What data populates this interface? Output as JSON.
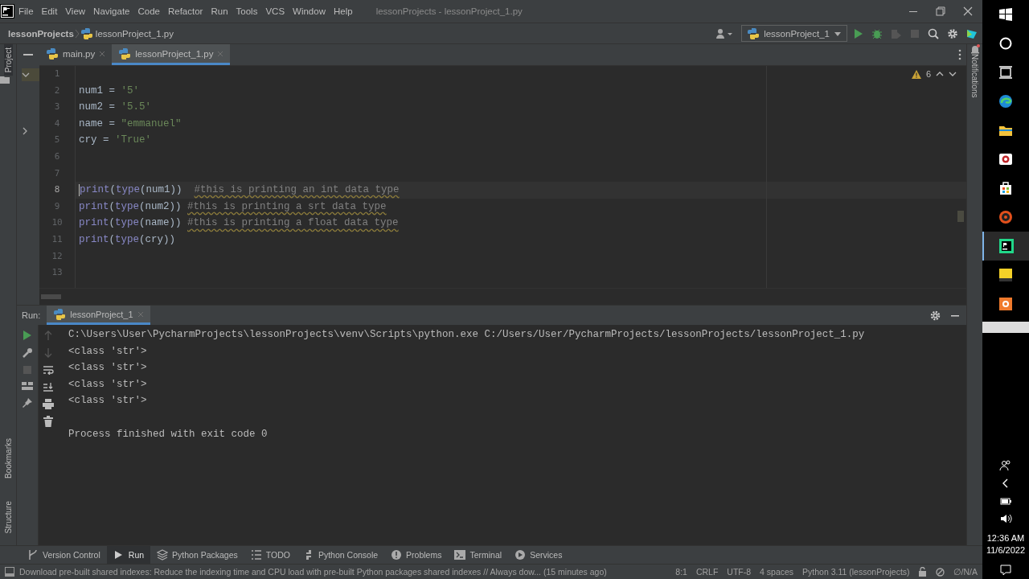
{
  "title_bar": {
    "menu": [
      "File",
      "Edit",
      "View",
      "Navigate",
      "Code",
      "Refactor",
      "Run",
      "Tools",
      "VCS",
      "Window",
      "Help"
    ],
    "title": "lessonProjects - lessonProject_1.py"
  },
  "nav_bar": {
    "breadcrumbs": [
      "lessonProjects",
      "lessonProject_1.py"
    ],
    "run_config": "lessonProject_1"
  },
  "left_strip": {
    "top": "Project",
    "bottom": [
      "Bookmarks",
      "Structure"
    ]
  },
  "right_strip": {
    "label": "Notifications"
  },
  "editor": {
    "tabs": [
      {
        "label": "main.py",
        "selected": false
      },
      {
        "label": "lessonProject_1.py",
        "selected": true
      }
    ],
    "warnings": "6",
    "lines": [
      {
        "number": "1",
        "current": false
      },
      {
        "number": "2",
        "current": false,
        "tokens": [
          {
            "kind": "ident",
            "text": "num1"
          },
          {
            "kind": "op",
            "text": " = "
          },
          {
            "kind": "str",
            "text": "'5'"
          }
        ]
      },
      {
        "number": "3",
        "current": false,
        "tokens": [
          {
            "kind": "ident",
            "text": "num2"
          },
          {
            "kind": "op",
            "text": " = "
          },
          {
            "kind": "str",
            "text": "'5.5'"
          }
        ]
      },
      {
        "number": "4",
        "current": false,
        "tokens": [
          {
            "kind": "ident",
            "text": "name"
          },
          {
            "kind": "op",
            "text": " = "
          },
          {
            "kind": "str",
            "text": "\"emmanuel\""
          }
        ]
      },
      {
        "number": "5",
        "current": false,
        "tokens": [
          {
            "kind": "ident",
            "text": "cry"
          },
          {
            "kind": "op",
            "text": " = "
          },
          {
            "kind": "str",
            "text": "'True'"
          }
        ]
      },
      {
        "number": "6",
        "current": false
      },
      {
        "number": "7",
        "current": false
      },
      {
        "number": "8",
        "current": true,
        "tokens": [
          {
            "kind": "func",
            "text": "print"
          },
          {
            "kind": "op",
            "text": "("
          },
          {
            "kind": "func",
            "text": "type"
          },
          {
            "kind": "op",
            "text": "(num1))  "
          },
          {
            "kind": "comment",
            "text": "#this is printing an int data type"
          }
        ]
      },
      {
        "number": "9",
        "current": false,
        "tokens": [
          {
            "kind": "func",
            "text": "print"
          },
          {
            "kind": "op",
            "text": "("
          },
          {
            "kind": "func",
            "text": "type"
          },
          {
            "kind": "op",
            "text": "(num2)) "
          },
          {
            "kind": "comment",
            "text": "#this is printing a srt data type"
          }
        ]
      },
      {
        "number": "10",
        "current": false,
        "tokens": [
          {
            "kind": "func",
            "text": "print"
          },
          {
            "kind": "op",
            "text": "("
          },
          {
            "kind": "func",
            "text": "type"
          },
          {
            "kind": "op",
            "text": "(name)) "
          },
          {
            "kind": "comment",
            "text": "#this is printing a float data type"
          }
        ]
      },
      {
        "number": "11",
        "current": false,
        "tokens": [
          {
            "kind": "func",
            "text": "print"
          },
          {
            "kind": "op",
            "text": "("
          },
          {
            "kind": "func",
            "text": "type"
          },
          {
            "kind": "op",
            "text": "(cry))"
          }
        ]
      },
      {
        "number": "12",
        "current": false
      },
      {
        "number": "13",
        "current": false
      }
    ]
  },
  "run_panel": {
    "label": "Run:",
    "tab": "lessonProject_1",
    "output": [
      "C:\\Users\\User\\PycharmProjects\\lessonProjects\\venv\\Scripts\\python.exe C:/Users/User/PycharmProjects/lessonProjects/lessonProject_1.py",
      "<class 'str'>",
      "<class 'str'>",
      "<class 'str'>",
      "<class 'str'>"
    ],
    "result": "Process finished with exit code 0"
  },
  "tool_windows": [
    {
      "kind": "vcs",
      "label": "Version Control",
      "selected": false
    },
    {
      "kind": "run",
      "label": "Run",
      "selected": true
    },
    {
      "kind": "packages",
      "label": "Python Packages",
      "selected": false
    },
    {
      "kind": "todo",
      "label": "TODO",
      "selected": false
    },
    {
      "kind": "console",
      "label": "Python Console",
      "selected": false
    },
    {
      "kind": "problems",
      "label": "Problems",
      "selected": false
    },
    {
      "kind": "terminal",
      "label": "Terminal",
      "selected": false
    },
    {
      "kind": "services",
      "label": "Services",
      "selected": false
    }
  ],
  "status_bar": {
    "message": "Download pre-built shared indexes: Reduce the indexing time and CPU load with pre-built Python packages shared indexes // Always dow... (15 minutes ago)",
    "items": [
      "8:1",
      "CRLF",
      "UTF-8",
      "4 spaces",
      "Python 3.11 (lessonProjects)"
    ],
    "vcs": "∅/N/A"
  },
  "taskbar": {
    "time": "12:36 AM",
    "date": "11/6/2022"
  }
}
